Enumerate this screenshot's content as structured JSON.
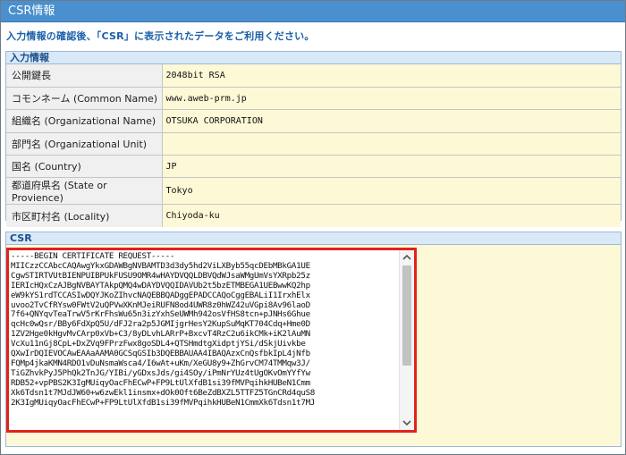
{
  "window": {
    "title": "CSR情報"
  },
  "intro_text": "入力情報の確認後、「CSR」に表示されたデータをご利用ください。",
  "input_section": {
    "heading": "入力情報",
    "rows": [
      {
        "label": "公開鍵長",
        "value": "2048bit RSA"
      },
      {
        "label": "コモンネーム (Common Name)",
        "value": "www.aweb-prm.jp"
      },
      {
        "label": "組織名 (Organizational Name)",
        "value": "OTSUKA CORPORATION"
      },
      {
        "label": "部門名 (Organizational Unit)",
        "value": ""
      },
      {
        "label": "国名 (Country)",
        "value": "JP"
      },
      {
        "label": "都道府県名 (State or Provience)",
        "value": "Tokyo"
      },
      {
        "label": "市区町村名 (Locality)",
        "value": "Chiyoda-ku"
      }
    ]
  },
  "csr_section": {
    "heading": "CSR",
    "text": "-----BEGIN CERTIFICATE REQUEST-----\nMIICzzCCAbcCAQAwgYkxGDAWBgNVBAMTD3d3dy5hd2ViLXByb55qcDEbMBkGA1UE\nCgwSTIRTVUtBIENPUIBPUkFUSU9OMR4wHAYDVQQLDBVQdWJsaWMgUmVsYXRpb25z\nIERIcHQxCzAJBgNVBAYTAkpQMQ4wDAYDVQQIDAVUb2t5bzETMBEGA1UEBwwKQ2hp\neW9kYS1rdTCCASIwDQYJKoZIhvcNAQEBBQADggEPADCCAQoCggEBALiI1IrxhElx\nuvoo2TvCfRYsw0FWtV2uQPVwXKnMJeiRUFN8od4UWR8z0hWZ42uVGpi8Av96laoD\n7f6+QNYqvTeaTrwV5rKrFhsWu65n3izYxhSeUWMh942osVfHS8tcn+pJNHs6Ghue\nqcHc0wQsr/BBy6FdXpQ5U/dFJ2ra2p5JGMIjgrHesY2KupSuMqKT704Cdq+Hme0D\n1ZV2Hge0kHgvMvCArp0xVb+C3/8yDLvhLARrP+BxcvT4RzC2u6ikCMk+iK2lAuMN\nVcXu11nGj8CpL+DxZVq9FPrzFwx8goSDL4+QTSHmdtgXidptjYSi/dSkjUivkbe\nQXwIrDQIEVOCAwEAAaAAMA0GCSqGSIb3DQEBBAUAA4IBAQAzxCnQsfbkIpL4jNfb\nFQMp4jkaKMN4RDO1vDuNsmaWsca4/I6wAt+uKm/XeGU8y9+ZhGrvCM74TMMqw3J/\nTiGZhvkPyJ5PhQk2TnJG/YIBi/yGDxsJds/gi4SOy/iPmNrYUz4tUgOKvOmYYfYw\nRDB52+vpPBS2K3IgMUiqyOacFhECwP+FP9LtUlXfdB1si39fMVPqihkHUBeN1Cmm\nXk6Tdsn1t7MJdJW60+w6zwEkl1insmx+dOk0Oft6BeZdBXZL5TTFZ5TGnCRd4quS8\n2K3IgMUiqyOacFhECwP+FP9LtUlXfdB1si39fMVPqihkHUBeN1CmmXk6Tdsn1t7MJ"
  }
}
